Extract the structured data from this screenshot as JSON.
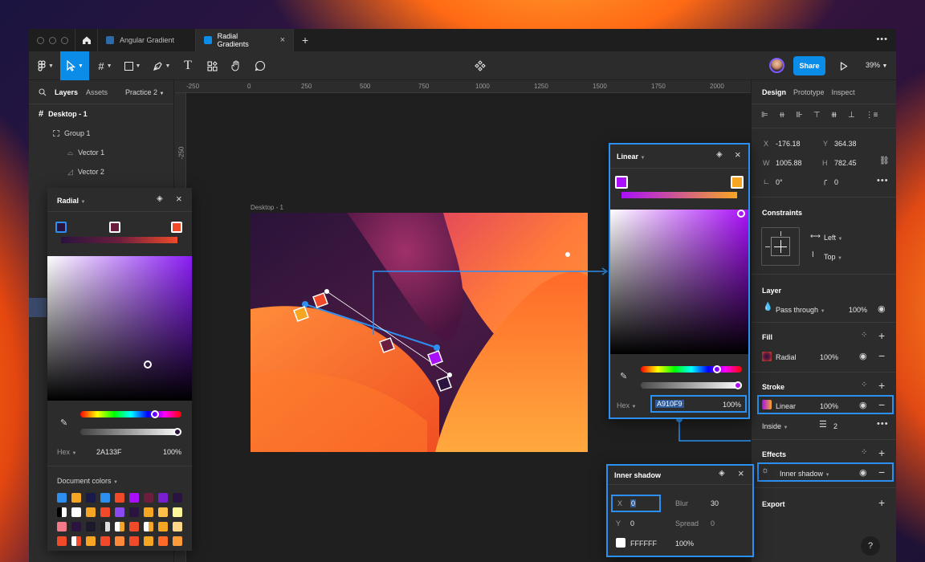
{
  "tabs": [
    {
      "label": "Angular Gradient"
    },
    {
      "label": "Radial Gradients"
    }
  ],
  "toolbar": {
    "share_label": "Share",
    "zoom": "39%"
  },
  "left_panel": {
    "tabs": {
      "layers": "Layers",
      "assets": "Assets",
      "page": "Practice 2"
    },
    "layers": [
      {
        "label": "Desktop - 1"
      },
      {
        "label": "Group 1"
      },
      {
        "label": "Vector 1"
      },
      {
        "label": "Vector 2"
      }
    ]
  },
  "ruler": {
    "ticks": [
      "-250",
      "0",
      "250",
      "500",
      "750",
      "1000",
      "1250",
      "1500",
      "1750",
      "2000"
    ],
    "vertical": "-250"
  },
  "canvas": {
    "frame_label": "Desktop - 1"
  },
  "radial_picker": {
    "mode": "Radial",
    "hex_label": "Hex",
    "hex_value": "2A133F",
    "opacity": "100%",
    "doc_colors_label": "Document colors",
    "colors": {
      "stop1": "#2a133f",
      "stop2": "#6b1e3d",
      "stop3": "#f04a2a"
    }
  },
  "linear_picker": {
    "mode": "Linear",
    "hex_label": "Hex",
    "hex_value": "A910F9",
    "opacity": "100%",
    "colors": {
      "stop1": "#a910f9",
      "stop2": "#f6a623"
    }
  },
  "inner_shadow": {
    "title": "Inner shadow",
    "x_label": "X",
    "x_value": "0",
    "y_label": "Y",
    "y_value": "0",
    "blur_label": "Blur",
    "blur_value": "30",
    "spread_label": "Spread",
    "spread_value": "0",
    "color_hex": "FFFFFF",
    "color_opacity": "100%"
  },
  "right_panel": {
    "tabs": {
      "design": "Design",
      "prototype": "Prototype",
      "inspect": "Inspect"
    },
    "x_label": "X",
    "x_value": "-176.18",
    "y_label": "Y",
    "y_value": "364.38",
    "w_label": "W",
    "w_value": "1005.88",
    "h_label": "H",
    "h_value": "782.45",
    "rotation": "0°",
    "radius": "0",
    "constraints": {
      "title": "Constraints",
      "horizontal": "Left",
      "vertical": "Top"
    },
    "layer": {
      "title": "Layer",
      "blend": "Pass through",
      "opacity": "100%"
    },
    "fill": {
      "title": "Fill",
      "type": "Radial",
      "opacity": "100%"
    },
    "stroke": {
      "title": "Stroke",
      "type": "Linear",
      "opacity": "100%",
      "position": "Inside",
      "weight": "2"
    },
    "effects": {
      "title": "Effects",
      "type": "Inner shadow"
    },
    "export": {
      "title": "Export"
    },
    "help": "?"
  }
}
